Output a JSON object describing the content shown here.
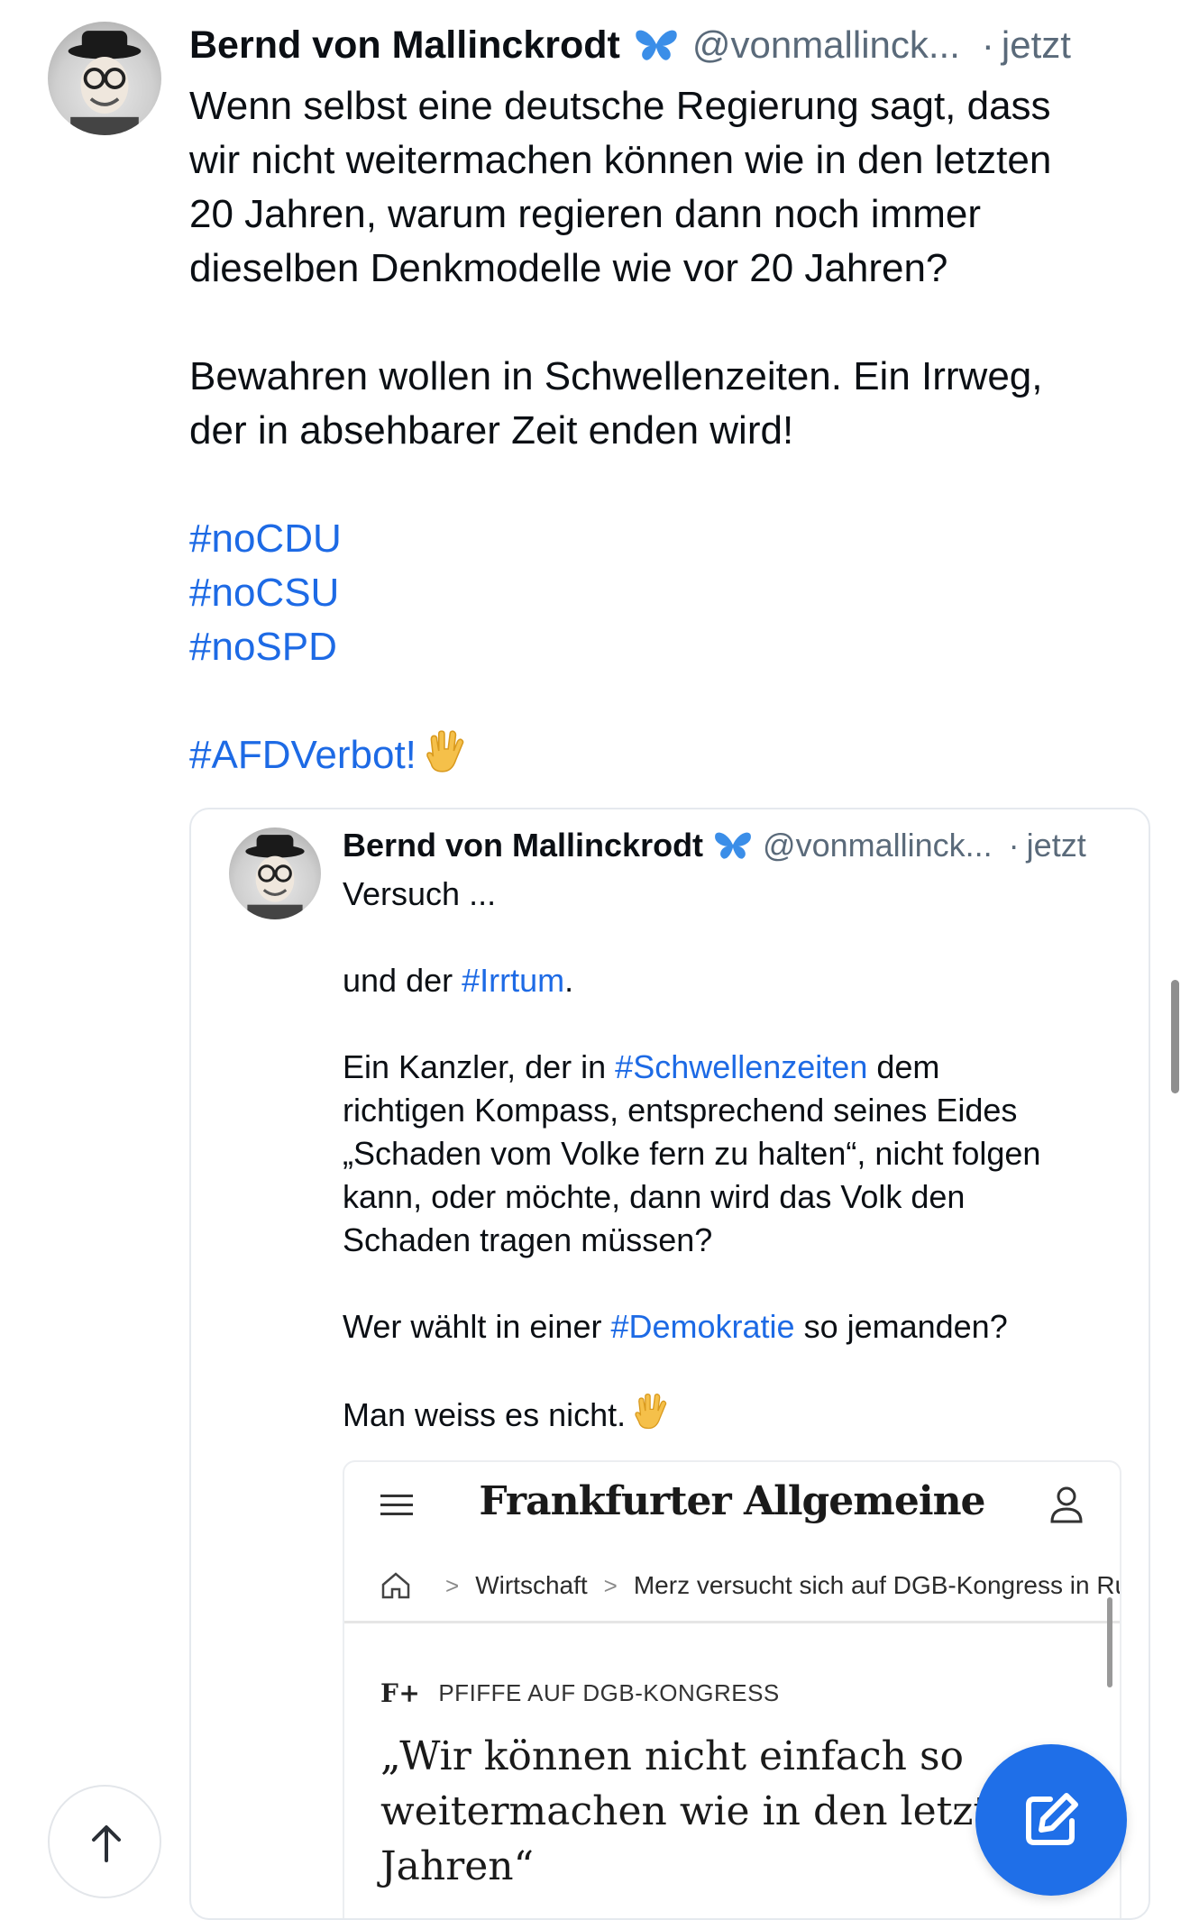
{
  "post": {
    "author": "Bernd von Mallinckrodt",
    "handle": "@vonmallinck...",
    "dot": "·",
    "time": "jetzt",
    "lines": [
      "Wenn selbst eine deutsche Regierung sagt, dass",
      "wir nicht weitermachen können wie in den letzten",
      "20 Jahren, warum regieren dann noch immer",
      "dieselben Denkmodelle wie vor 20 Jahren?"
    ],
    "para2": [
      "Bewahren wollen in Schwellenzeiten. Ein Irrweg,",
      "der in absehbarer Zeit enden wird!"
    ],
    "hashtags": [
      "#noCDU",
      "#noCSU",
      "#noSPD"
    ],
    "final_tag": "#AFDVerbot!",
    "accent_color": "#1d6ae5"
  },
  "quote": {
    "author": "Bernd von Mallinckrodt",
    "handle": "@vonmallinck...",
    "dot": "·",
    "time": "jetzt",
    "line1": "Versuch ...",
    "l2_pre": "und der ",
    "l2_tag": "#Irrtum",
    "l2_post": ".",
    "l3_pre": "Ein Kanzler, der in ",
    "l3_tag": "#Schwellenzeiten",
    "l3_post": " dem",
    "l4": "richtigen Kompass, entsprechend seines Eides",
    "l5": "„Schaden vom Volke fern zu halten“, nicht folgen",
    "l6": "kann, oder möchte, dann wird das Volk den",
    "l7": "Schaden tragen müssen?",
    "l8_pre": "Wer wählt in einer ",
    "l8_tag": "#Demokratie",
    "l8_post": " so jemanden?",
    "l9": "Man weiss es nicht."
  },
  "article": {
    "logo": "Frankfurter Allgemeine",
    "breadcrumb": [
      "Wirtschaft",
      "Merz versucht sich auf DGB-Kongress in Ruck"
    ],
    "sep": ">",
    "kicker_brand": "F+",
    "kicker": "PFIFFE AUF DGB-KONGRESS",
    "headline": [
      "„Wir können nicht einfach so",
      "weitermachen wie in den letzten",
      "Jahren“"
    ]
  },
  "icons": {
    "butterfly": "butterfly-icon",
    "hand": "vulcan-salute-icon",
    "scroll_top": "arrow-up-icon",
    "compose": "compose-icon",
    "menu": "hamburger-menu-icon",
    "user": "user-icon",
    "home": "home-icon"
  },
  "colors": {
    "compose_button": "#1f6fe8",
    "handle_gray": "#5a6a7a"
  }
}
